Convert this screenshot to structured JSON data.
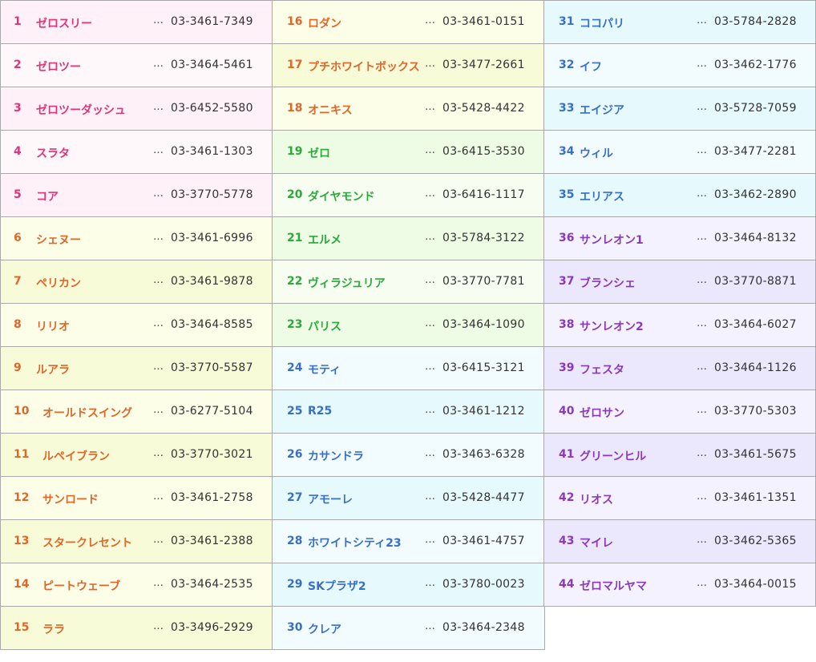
{
  "columns": [
    {
      "items": [
        {
          "no": "1",
          "name": "ゼロスリー",
          "tel": "03-3461-7349",
          "bg": "#fff1f7",
          "color": "#e0337a"
        },
        {
          "no": "2",
          "name": "ゼロツー",
          "tel": "03-3464-5461",
          "bg": "#fff8fb",
          "color": "#e0337a"
        },
        {
          "no": "3",
          "name": "ゼロツーダッシュ",
          "tel": "03-6452-5580",
          "bg": "#fff1f7",
          "color": "#e0337a"
        },
        {
          "no": "4",
          "name": "スラタ",
          "tel": "03-3461-1303",
          "bg": "#fff8fb",
          "color": "#e0337a"
        },
        {
          "no": "5",
          "name": "コア",
          "tel": "03-3770-5778",
          "bg": "#fff1f7",
          "color": "#e0337a"
        },
        {
          "no": "6",
          "name": "シェヌー",
          "tel": "03-3461-6996",
          "bg": "#fdfee8",
          "color": "#e0662a"
        },
        {
          "no": "7",
          "name": "ペリカン",
          "tel": "03-3461-9878",
          "bg": "#f8fbd8",
          "color": "#e0662a"
        },
        {
          "no": "8",
          "name": "リリオ",
          "tel": "03-3464-8585",
          "bg": "#fdfee8",
          "color": "#e0662a"
        },
        {
          "no": "9",
          "name": "ルアラ",
          "tel": "03-3770-5587",
          "bg": "#f8fbd8",
          "color": "#e0662a"
        },
        {
          "no": "10",
          "name": "オールドスイング",
          "tel": "03-6277-5104",
          "bg": "#fdfee8",
          "color": "#e0662a"
        },
        {
          "no": "11",
          "name": "ルペイブラン",
          "tel": "03-3770-3021",
          "bg": "#f8fbd8",
          "color": "#e0662a"
        },
        {
          "no": "12",
          "name": "サンロード",
          "tel": "03-3461-2758",
          "bg": "#fdfee8",
          "color": "#e0662a"
        },
        {
          "no": "13",
          "name": "スタークレセント",
          "tel": "03-3461-2388",
          "bg": "#f8fbd8",
          "color": "#e0662a"
        },
        {
          "no": "14",
          "name": "ピートウェーブ",
          "tel": "03-3464-2535",
          "bg": "#fdfee8",
          "color": "#e0662a"
        },
        {
          "no": "15",
          "name": "ララ",
          "tel": "03-3496-2929",
          "bg": "#f8fbd8",
          "color": "#e0662a"
        }
      ]
    },
    {
      "items": [
        {
          "no": "16",
          "name": "ロダン",
          "tel": "03-3461-0151",
          "bg": "#fdfee8",
          "color": "#e0662a"
        },
        {
          "no": "17",
          "name": "プチホワイトボックス",
          "tel": "03-3477-2661",
          "bg": "#f8fbd8",
          "color": "#e0662a"
        },
        {
          "no": "18",
          "name": "オニキス",
          "tel": "03-5428-4422",
          "bg": "#fdfee8",
          "color": "#e0662a"
        },
        {
          "no": "19",
          "name": "ゼロ",
          "tel": "03-6415-3530",
          "bg": "#eefce5",
          "color": "#2aaa3a"
        },
        {
          "no": "20",
          "name": "ダイヤモンド",
          "tel": "03-6416-1117",
          "bg": "#f7fef1",
          "color": "#2aaa3a"
        },
        {
          "no": "21",
          "name": "エルメ",
          "tel": "03-5784-3122",
          "bg": "#eefce5",
          "color": "#2aaa3a"
        },
        {
          "no": "22",
          "name": "ヴィラジュリア",
          "tel": "03-3770-7781",
          "bg": "#f7fef1",
          "color": "#2aaa3a"
        },
        {
          "no": "23",
          "name": "パリス",
          "tel": "03-3464-1090",
          "bg": "#eefce5",
          "color": "#2aaa3a"
        },
        {
          "no": "24",
          "name": "モティ",
          "tel": "03-6415-3121",
          "bg": "#f2fcfe",
          "color": "#3a6fc8"
        },
        {
          "no": "25",
          "name": "R25",
          "tel": "03-3461-1212",
          "bg": "#e6f9fd",
          "color": "#3a6fc8"
        },
        {
          "no": "26",
          "name": "カサンドラ",
          "tel": "03-3463-6328",
          "bg": "#f2fcfe",
          "color": "#3a6fc8"
        },
        {
          "no": "27",
          "name": "アモーレ",
          "tel": "03-5428-4477",
          "bg": "#e6f9fd",
          "color": "#3a6fc8"
        },
        {
          "no": "28",
          "name": "ホワイトシティ23",
          "tel": "03-3461-4757",
          "bg": "#f2fcfe",
          "color": "#3a6fc8"
        },
        {
          "no": "29",
          "name": "SKプラザ2",
          "tel": "03-3780-0023",
          "bg": "#e6f9fd",
          "color": "#3a6fc8"
        },
        {
          "no": "30",
          "name": "クレア",
          "tel": "03-3464-2348",
          "bg": "#f2fcfe",
          "color": "#3a6fc8"
        }
      ]
    },
    {
      "items": [
        {
          "no": "31",
          "name": "ココパリ",
          "tel": "03-5784-2828",
          "bg": "#e6f9fd",
          "color": "#3a6fc8"
        },
        {
          "no": "32",
          "name": "イフ",
          "tel": "03-3462-1776",
          "bg": "#f2fcfe",
          "color": "#3a6fc8"
        },
        {
          "no": "33",
          "name": "エイジア",
          "tel": "03-5728-7059",
          "bg": "#e6f9fd",
          "color": "#3a6fc8"
        },
        {
          "no": "34",
          "name": "ウィル",
          "tel": "03-3477-2281",
          "bg": "#f2fcfe",
          "color": "#3a6fc8"
        },
        {
          "no": "35",
          "name": "エリアス",
          "tel": "03-3462-2890",
          "bg": "#e6f9fd",
          "color": "#3a6fc8"
        },
        {
          "no": "36",
          "name": "サンレオン1",
          "tel": "03-3464-8132",
          "bg": "#f4f2fe",
          "color": "#8a3ab8"
        },
        {
          "no": "37",
          "name": "ブランシェ",
          "tel": "03-3770-8871",
          "bg": "#ebe7fd",
          "color": "#8a3ab8"
        },
        {
          "no": "38",
          "name": "サンレオン2",
          "tel": "03-3464-6027",
          "bg": "#f4f2fe",
          "color": "#8a3ab8"
        },
        {
          "no": "39",
          "name": "フェスタ",
          "tel": "03-3464-1126",
          "bg": "#ebe7fd",
          "color": "#8a3ab8"
        },
        {
          "no": "40",
          "name": "ゼロサン",
          "tel": "03-3770-5303",
          "bg": "#f4f2fe",
          "color": "#8a3ab8"
        },
        {
          "no": "41",
          "name": "グリーンヒル",
          "tel": "03-3461-5675",
          "bg": "#ebe7fd",
          "color": "#8a3ab8"
        },
        {
          "no": "42",
          "name": "リオス",
          "tel": "03-3461-1351",
          "bg": "#f4f2fe",
          "color": "#8a3ab8"
        },
        {
          "no": "43",
          "name": "マイレ",
          "tel": "03-3462-5365",
          "bg": "#ebe7fd",
          "color": "#8a3ab8"
        },
        {
          "no": "44",
          "name": "ゼロマルヤマ",
          "tel": "03-3464-0015",
          "bg": "#f4f2fe",
          "color": "#8a3ab8"
        }
      ]
    }
  ],
  "separator": "…"
}
